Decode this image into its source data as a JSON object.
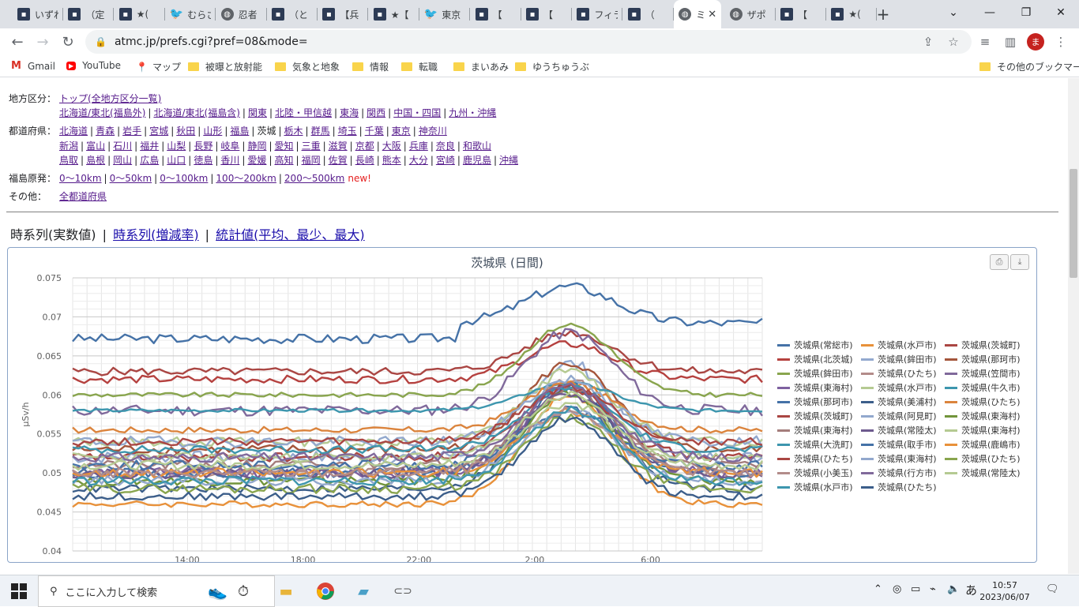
{
  "tabs": [
    {
      "label": "いずれ",
      "icon": "dark"
    },
    {
      "label": "（定",
      "icon": "dark"
    },
    {
      "label": "★(",
      "icon": "dark"
    },
    {
      "label": "むらさ",
      "icon": "twitter"
    },
    {
      "label": "忍者",
      "icon": "globe"
    },
    {
      "label": "（と",
      "icon": "dark"
    },
    {
      "label": "【兵",
      "icon": "dark"
    },
    {
      "label": "★【",
      "icon": "dark"
    },
    {
      "label": "東京",
      "icon": "twitter"
    },
    {
      "label": "【",
      "icon": "dark"
    },
    {
      "label": "【",
      "icon": "dark"
    },
    {
      "label": "フィラ",
      "icon": "dark"
    },
    {
      "label": "（",
      "icon": "dark"
    },
    {
      "label": "ミ",
      "icon": "globe",
      "active": true
    },
    {
      "label": "ザポ",
      "icon": "globe"
    },
    {
      "label": "【",
      "icon": "dark"
    },
    {
      "label": "★(",
      "icon": "dark"
    }
  ],
  "browser": {
    "url": "atmc.jp/prefs.cgi?pref=08&mode=",
    "avatar": "ま",
    "other_bookmarks": "その他のブックマーク"
  },
  "bookmarks": [
    {
      "label": "Gmail",
      "icon": "gmail-icon"
    },
    {
      "label": "YouTube",
      "icon": "youtube-icon"
    },
    {
      "label": "マップ",
      "icon": "maps-icon"
    },
    {
      "label": "被曝と放射能",
      "icon": "folder-icon"
    },
    {
      "label": "気象と地象",
      "icon": "folder-icon"
    },
    {
      "label": "情報",
      "icon": "folder-icon"
    },
    {
      "label": "転職",
      "icon": "folder-icon"
    },
    {
      "label": "まいあみ",
      "icon": "folder-icon"
    },
    {
      "label": "ゆうちゅうぶ",
      "icon": "folder-icon"
    }
  ],
  "nav": {
    "region_label": "地方区分：",
    "region_top": "トップ(全地方区分一覧)",
    "regions": [
      "北海道/東北(福島外)",
      "北海道/東北(福島含)",
      "関東",
      "北陸・甲信越",
      "東海",
      "関西",
      "中国・四国",
      "九州・沖縄"
    ],
    "pref_label": "都道府県：",
    "prefs_row1": [
      "北海道",
      "青森",
      "岩手",
      "宮城",
      "秋田",
      "山形",
      "福島",
      "茨城",
      "栃木",
      "群馬",
      "埼玉",
      "千葉",
      "東京",
      "神奈川"
    ],
    "prefs_row2": [
      "新潟",
      "富山",
      "石川",
      "福井",
      "山梨",
      "長野",
      "岐阜",
      "静岡",
      "愛知",
      "三重",
      "滋賀",
      "京都",
      "大阪",
      "兵庫",
      "奈良",
      "和歌山"
    ],
    "prefs_row3": [
      "鳥取",
      "島根",
      "岡山",
      "広島",
      "山口",
      "徳島",
      "香川",
      "愛媛",
      "高知",
      "福岡",
      "佐賀",
      "長崎",
      "熊本",
      "大分",
      "宮崎",
      "鹿児島",
      "沖縄"
    ],
    "current_pref": "茨城",
    "fukushima_label": "福島原発：",
    "fukushima": [
      "0～10km",
      "0～50km",
      "0～100km",
      "100～200km",
      "200～500km"
    ],
    "new_tag": "new!",
    "other_label": "その他：",
    "other": "全都道府県"
  },
  "modes": {
    "current": "時系列(実数値)",
    "links": [
      "時系列(増減率)",
      "統計値(平均、最少、最大)"
    ]
  },
  "chart_data": {
    "type": "line",
    "title": "茨城県 (日間)",
    "ylabel": "µSv/h",
    "ylim": [
      0.04,
      0.075
    ],
    "yticks": [
      "0.04",
      "0.045",
      "0.05",
      "0.055",
      "0.06",
      "0.065",
      "0.07",
      "0.075"
    ],
    "xticks": [
      "14:00",
      "18:00",
      "22:00",
      "2:00",
      "6:00"
    ],
    "grid": true,
    "legend_position": "right",
    "series": [
      {
        "name": "茨城県(常総市)",
        "color": "#4572a7",
        "base": 0.0672,
        "peak": 0.0047,
        "spread": 0.0006
      },
      {
        "name": "茨城県(水戸市)",
        "color": "#e8913a",
        "base": 0.046,
        "peak": 0.014,
        "spread": 0.0004
      },
      {
        "name": "茨城県(茨城町)",
        "color": "#aa4643",
        "base": 0.063,
        "peak": 0.005,
        "spread": 0.0005
      },
      {
        "name": "茨城県(北茨城)",
        "color": "#b5413f",
        "base": 0.062,
        "peak": 0.0045,
        "spread": 0.0005
      },
      {
        "name": "茨城県(鉾田市)",
        "color": "#93a9cf",
        "base": 0.052,
        "peak": 0.012,
        "spread": 0.0008
      },
      {
        "name": "茨城県(那珂市)",
        "color": "#a4553b",
        "base": 0.053,
        "peak": 0.011,
        "spread": 0.0006
      },
      {
        "name": "茨城県(鉾田市)",
        "color": "#89a54e",
        "base": 0.06,
        "peak": 0.009,
        "spread": 0.0003
      },
      {
        "name": "茨城県(ひたち)",
        "color": "#b38c8a",
        "base": 0.05,
        "peak": 0.012,
        "spread": 0.0006
      },
      {
        "name": "茨城県(笠間市)",
        "color": "#80699b",
        "base": 0.058,
        "peak": 0.01,
        "spread": 0.0007
      },
      {
        "name": "茨城県(東海村)",
        "color": "#7e61a0",
        "base": 0.05,
        "peak": 0.011,
        "spread": 0.0008
      },
      {
        "name": "茨城県(水戸市)",
        "color": "#b5ca92",
        "base": 0.054,
        "peak": 0.009,
        "spread": 0.0006
      },
      {
        "name": "茨城県(牛久市)",
        "color": "#3d96ae",
        "base": 0.058,
        "peak": 0.0035,
        "spread": 0.0002
      },
      {
        "name": "茨城県(那珂市)",
        "color": "#4572a7",
        "base": 0.05,
        "peak": 0.011,
        "spread": 0.0006
      },
      {
        "name": "茨城県(美浦村)",
        "color": "#3c5e8a",
        "base": 0.048,
        "peak": 0.013,
        "spread": 0.0005
      },
      {
        "name": "茨城県(ひたち)",
        "color": "#db843d",
        "base": 0.0555,
        "peak": 0.006,
        "spread": 0.0004
      },
      {
        "name": "茨城県(茨城町)",
        "color": "#aa4643",
        "base": 0.052,
        "peak": 0.009,
        "spread": 0.0006
      },
      {
        "name": "茨城県(阿見町)",
        "color": "#92a8cd",
        "base": 0.054,
        "peak": 0.008,
        "spread": 0.0007
      },
      {
        "name": "茨城県(東海村)",
        "color": "#71943a",
        "base": 0.049,
        "peak": 0.011,
        "spread": 0.0006
      },
      {
        "name": "茨城県(東海村)",
        "color": "#a47d7c",
        "base": 0.051,
        "peak": 0.0095,
        "spread": 0.0006
      },
      {
        "name": "茨城県(常陸太)",
        "color": "#6d5a8e",
        "base": 0.05,
        "peak": 0.01,
        "spread": 0.0007
      },
      {
        "name": "茨城県(東海村)",
        "color": "#b5ca92",
        "base": 0.052,
        "peak": 0.008,
        "spread": 0.0006
      },
      {
        "name": "茨城県(大洗町)",
        "color": "#3d96ae",
        "base": 0.053,
        "peak": 0.008,
        "spread": 0.0005
      },
      {
        "name": "茨城県(取手市)",
        "color": "#4572a7",
        "base": 0.051,
        "peak": 0.007,
        "spread": 0.0006
      },
      {
        "name": "茨城県(鹿嶋市)",
        "color": "#e8913a",
        "base": 0.05,
        "peak": 0.008,
        "spread": 0.0006
      },
      {
        "name": "茨城県(ひたち)",
        "color": "#aa4643",
        "base": 0.054,
        "peak": 0.007,
        "spread": 0.0005
      },
      {
        "name": "茨城県(東海村)",
        "color": "#92a8cd",
        "base": 0.049,
        "peak": 0.009,
        "spread": 0.0006
      },
      {
        "name": "茨城県(ひたち)",
        "color": "#89a54e",
        "base": 0.048,
        "peak": 0.009,
        "spread": 0.0006
      },
      {
        "name": "茨城県(小美玉)",
        "color": "#b38c8a",
        "base": 0.05,
        "peak": 0.008,
        "spread": 0.0006
      },
      {
        "name": "茨城県(行方市)",
        "color": "#80699b",
        "base": 0.052,
        "peak": 0.009,
        "spread": 0.0006
      },
      {
        "name": "茨城県(常陸太)",
        "color": "#b5ca92",
        "base": 0.051,
        "peak": 0.008,
        "spread": 0.0006
      },
      {
        "name": "茨城県(水戸市)",
        "color": "#3d96ae",
        "base": 0.049,
        "peak": 0.009,
        "spread": 0.0006
      },
      {
        "name": "茨城県(ひたち)",
        "color": "#3c5e8a",
        "base": 0.047,
        "peak": 0.01,
        "spread": 0.0005
      }
    ]
  },
  "taskbar": {
    "search_placeholder": "ここに入力して検索",
    "time": "10:57",
    "date": "2023/06/07",
    "ime": "あ"
  }
}
